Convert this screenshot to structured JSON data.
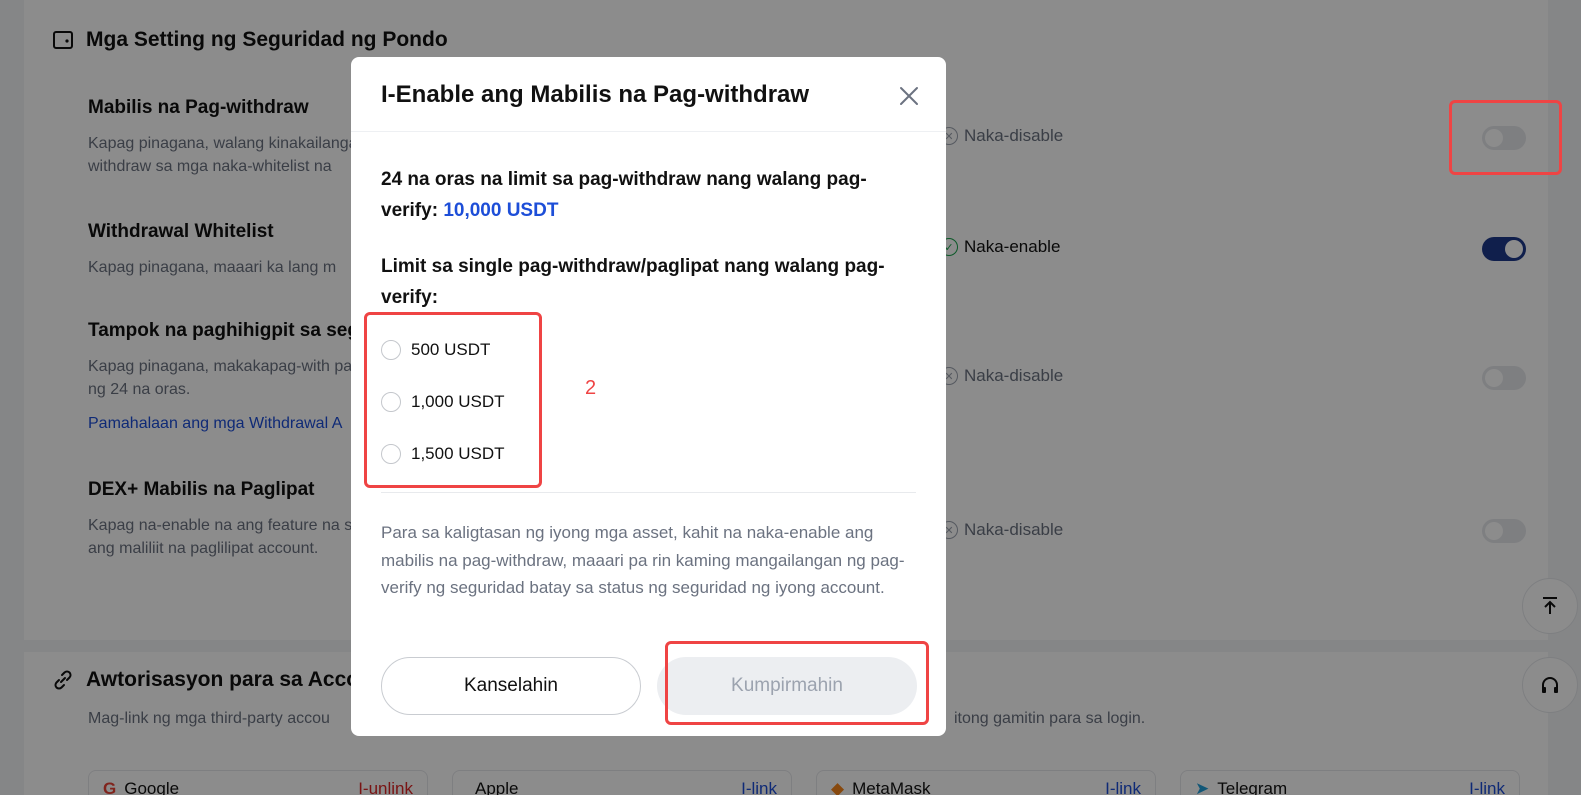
{
  "background": {
    "section_title": "Mga Setting ng Seguridad ng Pondo",
    "settings": [
      {
        "title": "Mabilis na Pag-withdraw",
        "desc": "Kapag pinagana, walang kinakailangang withdraw sa mga naka-whitelist na",
        "status": "Naka-disable",
        "enabled": false
      },
      {
        "title": "Withdrawal Whitelist",
        "desc": "Kapag pinagana, maaari ka lang m",
        "status": "Naka-enable",
        "enabled": true
      },
      {
        "title": "Tampok na paghihigpit sa seg",
        "desc": "Kapag pinagana, makakapag-with pagkatapos ng 24 na oras.",
        "link": "Pamahalaan ang mga Withdrawal A",
        "status": "Naka-disable",
        "enabled": false
      },
      {
        "title": "DEX+ Mabilis na Paglipat",
        "desc": "Kapag na-enable na ang feature na seguridad ang maliliit na paglilipat account.",
        "status": "Naka-disable",
        "enabled": false
      }
    ],
    "auth_section_title": "Awtorisasyon para sa Acco",
    "auth_sub_left": "Mag-link ng mga third-party accou",
    "auth_sub_right": "itong gamitin para sa login.",
    "accounts": [
      {
        "name": "Google",
        "action": "I-unlink"
      },
      {
        "name": "Apple",
        "action": "I-link"
      },
      {
        "name": "MetaMask",
        "action": "I-link"
      },
      {
        "name": "Telegram",
        "action": "I-link"
      }
    ]
  },
  "modal": {
    "title": "I-Enable ang Mabilis na Pag-withdraw",
    "limit_24h_label": "24 na oras na limit sa pag-withdraw nang walang pag-verify:",
    "limit_24h_value": "10,000 USDT",
    "single_limit_label": "Limit sa single pag-withdraw/paglipat nang walang pag-verify:",
    "options": [
      "500 USDT",
      "1,000 USDT",
      "1,500 USDT"
    ],
    "note": "Para sa kaligtasan ng iyong mga asset, kahit na naka-enable ang mabilis na pag-withdraw, maaari pa rin kaming mangailangan ng pag-verify ng seguridad batay sa status ng seguridad ng iyong account.",
    "cancel_label": "Kanselahin",
    "confirm_label": "Kumpirmahin"
  },
  "annotation": {
    "number": "2",
    "color": "#ef4444"
  }
}
